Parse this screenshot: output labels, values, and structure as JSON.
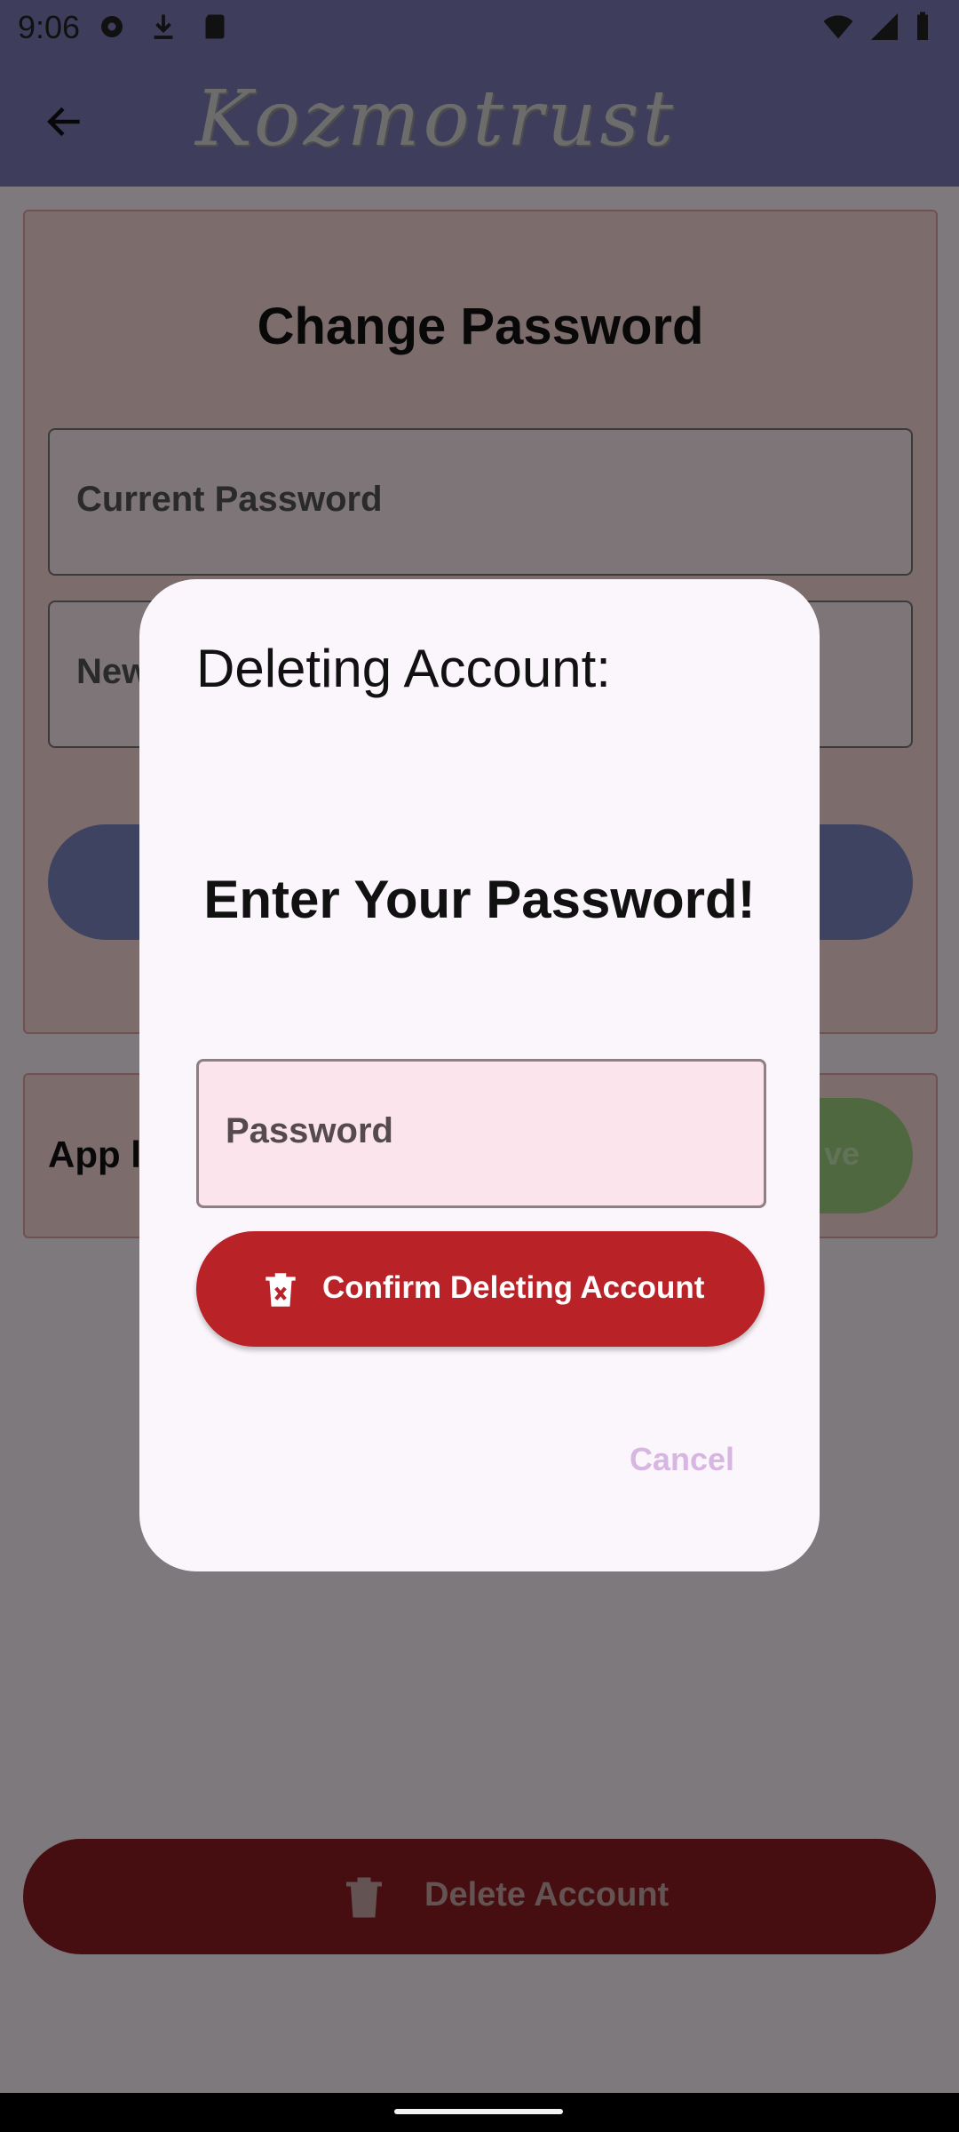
{
  "status_bar": {
    "time": "9:06"
  },
  "app_bar": {
    "title": "Kozmotrust"
  },
  "change_password_card": {
    "title": "Change Password",
    "current_password_placeholder": "Current Password",
    "new_password_placeholder_visible": "New"
  },
  "language_card": {
    "label_visible": "App la",
    "button_visible": "ve"
  },
  "delete_button": {
    "label": "Delete Account"
  },
  "dialog": {
    "title": "Deleting Account:",
    "heading": "Enter Your Password!",
    "password_placeholder": "Password",
    "confirm_label": "Confirm Deleting Account",
    "cancel_label": "Cancel"
  },
  "colors": {
    "app_bar": "#7f7bb8",
    "confirm_button": "#b92227",
    "delete_button": "#8e1c22",
    "dialog_bg": "#fbf6fc",
    "cancel_text": "#d7b6e1"
  },
  "icons": {
    "status_left": [
      "settings-icon",
      "download-icon",
      "sd-card-icon"
    ],
    "status_right": [
      "wifi-icon",
      "signal-icon",
      "battery-icon"
    ],
    "back": "arrow-left-icon",
    "confirm": "delete-forever-icon",
    "delete": "trash-icon"
  }
}
